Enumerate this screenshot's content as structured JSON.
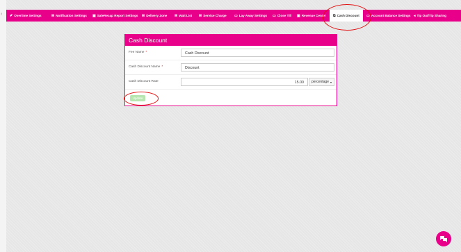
{
  "nav": {
    "tabs": [
      {
        "label": "Overtime Settings",
        "icon": "edit-icon",
        "glyph": "✐"
      },
      {
        "label": "Notification Settings",
        "icon": "envelope-icon",
        "glyph": "✉"
      },
      {
        "label": "SaleRecap Report Settings",
        "icon": "save-icon",
        "glyph": "▣"
      },
      {
        "label": "Delivery Zone",
        "icon": "envelope-icon",
        "glyph": "✉"
      },
      {
        "label": "Wait List",
        "icon": "envelope-icon",
        "glyph": "✉"
      },
      {
        "label": "Service Charge",
        "icon": "envelope-icon",
        "glyph": "✉"
      },
      {
        "label": "Lay Away Settings",
        "icon": "card-icon",
        "glyph": "▭"
      },
      {
        "label": "Close Till",
        "icon": "card-icon",
        "glyph": "▭"
      },
      {
        "label": "Revenue Center",
        "icon": "save-icon",
        "glyph": "▣"
      },
      {
        "label": "Cash Discount",
        "icon": "external-link-icon",
        "glyph": "⧉"
      },
      {
        "label": "Account Balance Settings",
        "icon": "card-icon",
        "glyph": "▭"
      },
      {
        "label": "Tip Out/Tip Sharing",
        "icon": "share-icon",
        "glyph": "◂"
      }
    ],
    "active_index": 9
  },
  "panel": {
    "title": "Cash Discount",
    "fields": [
      {
        "label": "Fee Name",
        "required": "*",
        "value": "Cash Discount"
      },
      {
        "label": "Cash Discount Name",
        "required": "*",
        "value": "Discount"
      }
    ],
    "rate": {
      "label": "Cash Discount Rate",
      "value": "15.00",
      "unit": "percentage"
    },
    "update_label": "Update"
  },
  "colors": {
    "brand": "#e8008a",
    "annotation": "#e01010",
    "update_button": "#b8e6b0"
  }
}
